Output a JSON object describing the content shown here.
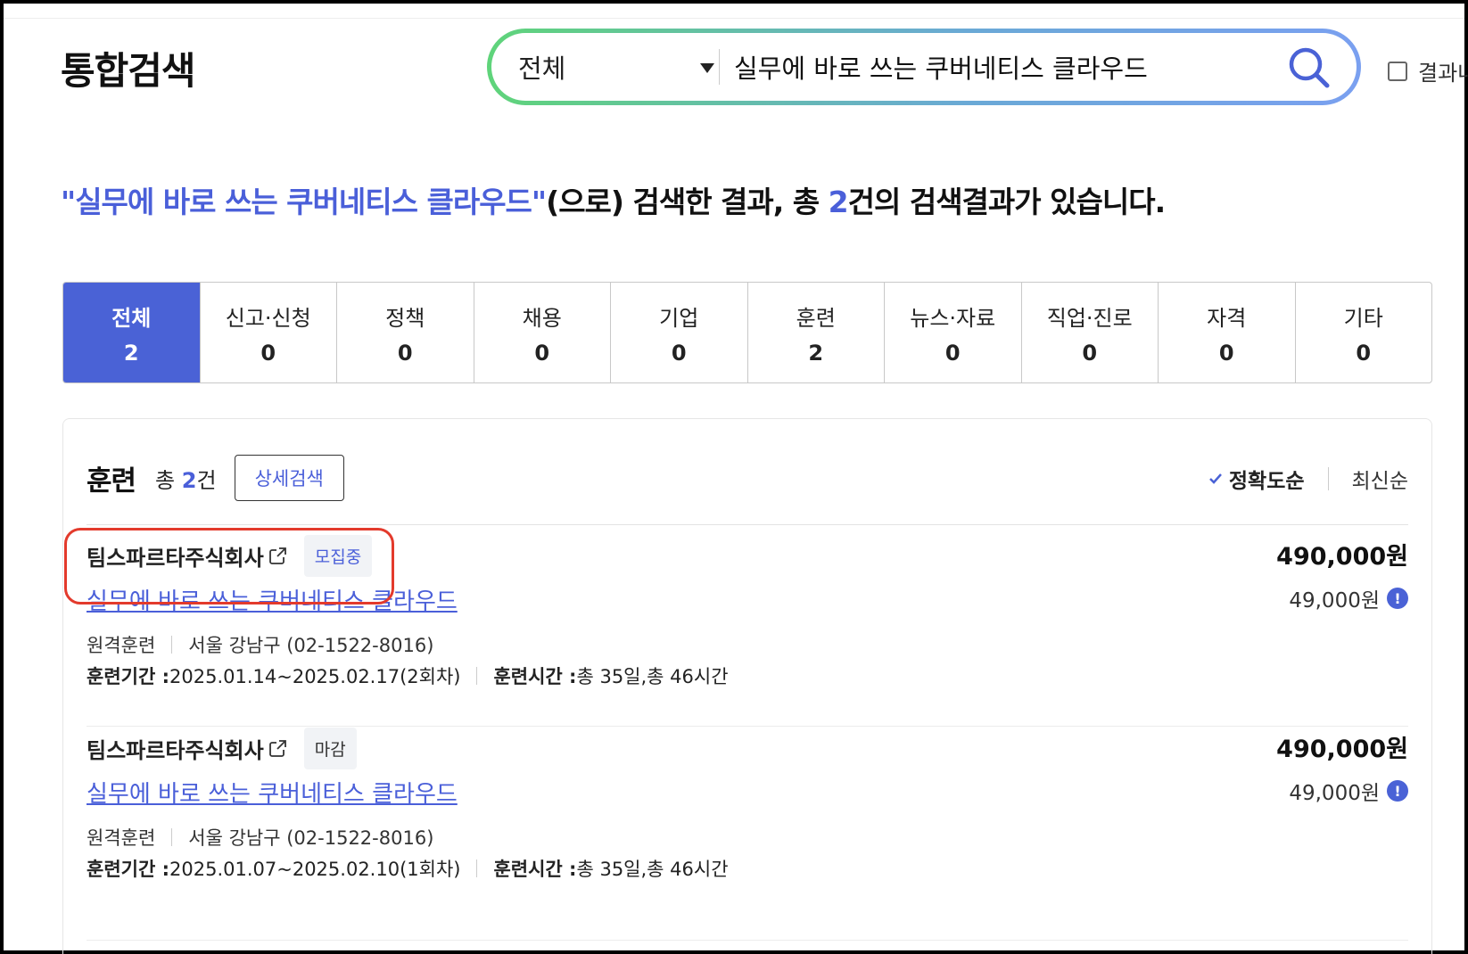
{
  "page": {
    "title": "통합검색"
  },
  "search": {
    "scope": "전체",
    "query": "실무에 바로 쓰는 쿠버네티스 클라우드",
    "within_results_label": "결과내"
  },
  "summary": {
    "query_quoted": "\"실무에 바로 쓰는 쿠버네티스 클라우드\"",
    "text1": "(으로) 검색한 결과, 총 ",
    "count": "2",
    "text2": "건의 검색결과가 있습니다."
  },
  "tabs": [
    {
      "label": "전체",
      "count": "2",
      "active": true
    },
    {
      "label": "신고·신청",
      "count": "0"
    },
    {
      "label": "정책",
      "count": "0"
    },
    {
      "label": "채용",
      "count": "0"
    },
    {
      "label": "기업",
      "count": "0"
    },
    {
      "label": "훈련",
      "count": "2"
    },
    {
      "label": "뉴스·자료",
      "count": "0"
    },
    {
      "label": "직업·진로",
      "count": "0"
    },
    {
      "label": "자격",
      "count": "0"
    },
    {
      "label": "기타",
      "count": "0"
    }
  ],
  "section": {
    "title": "훈련",
    "count_prefix": "총 ",
    "count": "2",
    "count_suffix": "건",
    "detail_button": "상세검색",
    "sort": {
      "accuracy": "정확도순",
      "latest": "최신순",
      "selected": "정확도순"
    }
  },
  "results": [
    {
      "org": "팀스파르타주식회사",
      "status": "모집중",
      "course": "실무에 바로 쓰는 쿠버네티스 클라우드",
      "type": "원격훈련",
      "location": "서울 강남구 (02-1522-8016)",
      "period_label": "훈련기간 : ",
      "period": "2025.01.14~2025.02.17(2회차)",
      "hours_label": "훈련시간 : ",
      "hours": "총 35일,총 46시간",
      "price": "490,000원",
      "sub_price": "49,000원"
    },
    {
      "org": "팀스파르타주식회사",
      "status": "마감",
      "course": "실무에 바로 쓰는 쿠버네티스 클라우드",
      "type": "원격훈련",
      "location": "서울 강남구 (02-1522-8016)",
      "period_label": "훈련기간 : ",
      "period": "2025.01.07~2025.02.10(1회차)",
      "hours_label": "훈련시간 : ",
      "hours": "총 35일,총 46시간",
      "price": "490,000원",
      "sub_price": "49,000원"
    }
  ],
  "colors": {
    "accent": "#4a62d6",
    "highlight": "#e33a2c"
  },
  "icons": [
    "search-icon",
    "chevron-down-icon",
    "external-link-icon",
    "info-icon",
    "check-icon"
  ]
}
